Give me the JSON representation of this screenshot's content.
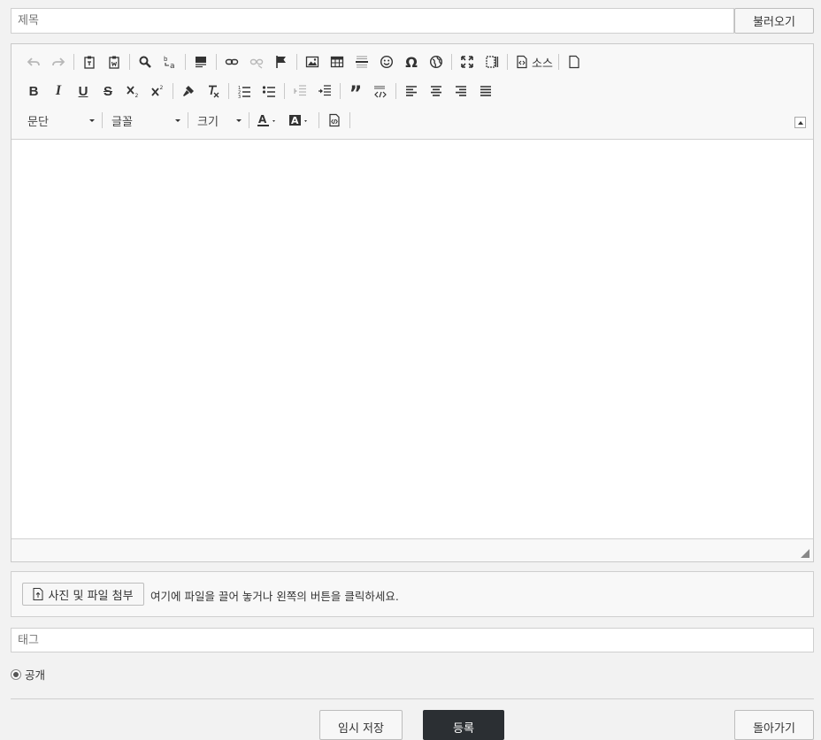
{
  "form": {
    "title_placeholder": "제목",
    "load_label": "불러오기",
    "tags_placeholder": "태그",
    "visibility_label": "공개"
  },
  "editor": {
    "source_label": "소스",
    "format_combo": "문단",
    "font_combo": "글꼴",
    "size_combo": "크기",
    "toolbar_row1_icons": [
      "undo-icon",
      "redo-icon",
      "paste-text-icon",
      "paste-word-icon",
      "find-icon",
      "replace-icon",
      "select-all-icon",
      "link-icon",
      "unlink-icon",
      "anchor-icon",
      "image-icon",
      "table-icon",
      "horizontal-rule-icon",
      "smiley-icon",
      "special-char-icon",
      "iframe-icon",
      "maximize-icon",
      "show-blocks-icon",
      "source-icon",
      "new-page-icon"
    ],
    "toolbar_row2_icons": [
      "bold-icon",
      "italic-icon",
      "underline-icon",
      "strike-icon",
      "subscript-icon",
      "superscript-icon",
      "copy-format-icon",
      "remove-format-icon",
      "numbered-list-icon",
      "bulleted-list-icon",
      "outdent-icon",
      "indent-icon",
      "blockquote-icon",
      "show-html-icon",
      "align-left-icon",
      "align-center-icon",
      "align-right-icon",
      "justify-icon"
    ],
    "toolbar_row3_icons": [
      "text-color-icon",
      "bg-color-icon",
      "code-snippet-icon"
    ]
  },
  "attach": {
    "button_label": "사진 및 파일 첨부",
    "hint": "여기에 파일을 끌어 놓거나 왼쪽의 버튼을 클릭하세요."
  },
  "actions": {
    "temp_save_label": "임시 저장",
    "submit_label": "등록",
    "back_label": "돌아가기"
  },
  "colors": {
    "submit_bg": "#2b2f33",
    "page_bg": "#f2f2f2"
  }
}
